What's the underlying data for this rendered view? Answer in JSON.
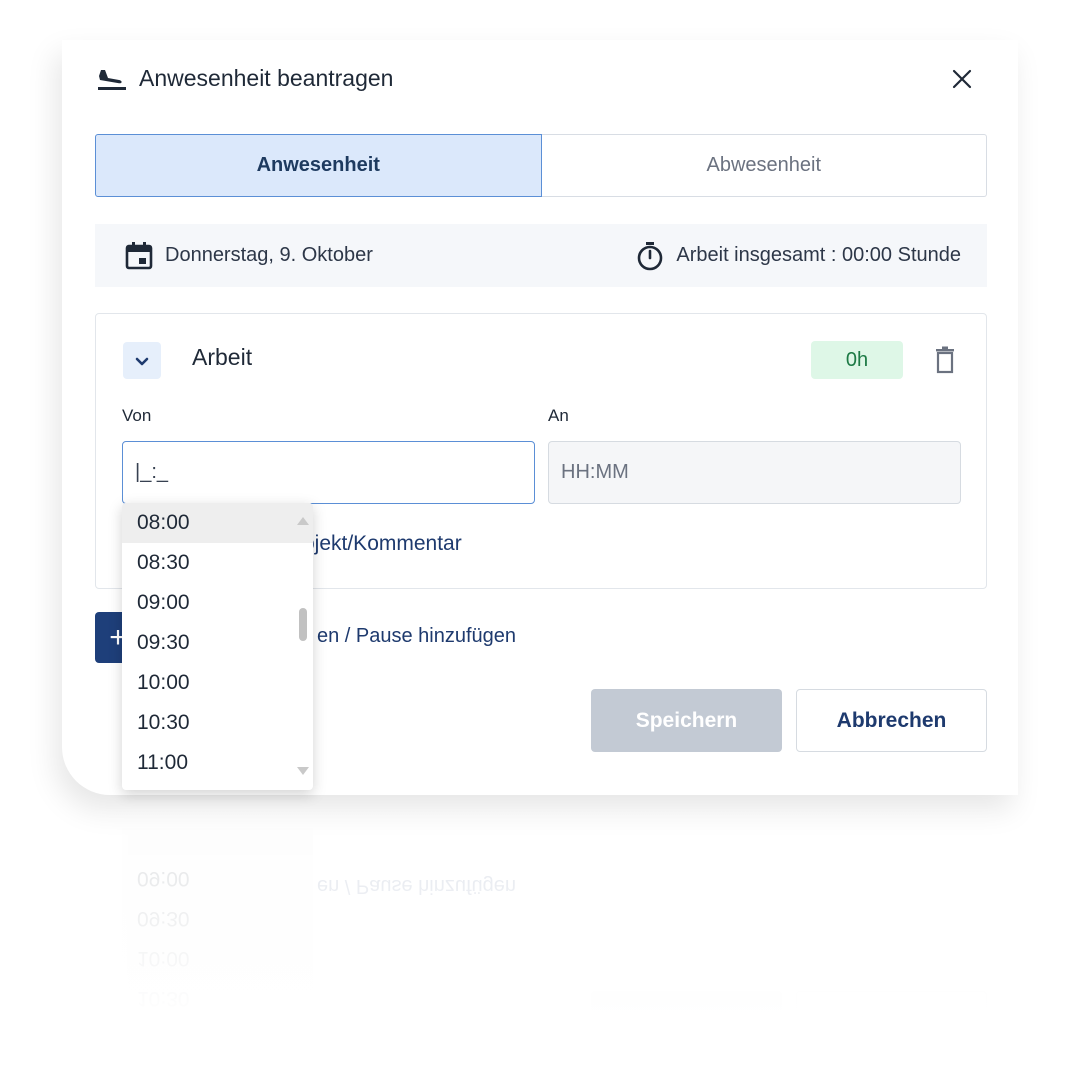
{
  "dialog": {
    "title": "Anwesenheit beantragen",
    "title_icon": "airplane-landing-icon",
    "close_icon": "close-icon"
  },
  "tabs": [
    {
      "label": "Anwesenheit",
      "active": true
    },
    {
      "label": "Abwesenheit",
      "active": false
    }
  ],
  "infobar": {
    "date": "Donnerstag, 9. Oktober",
    "date_icon": "calendar-icon",
    "total": "Arbeit insgesamt : 00:00 Stunde",
    "total_icon": "stopwatch-icon"
  },
  "entry": {
    "title": "Arbeit",
    "hours": "0h",
    "von_label": "Von",
    "von_value": "|_:_",
    "an_label": "An",
    "an_placeholder": "HH:MM",
    "comment_link": "Projekt/Kommentar",
    "comment_link_visible": "rojekt/Kommentar"
  },
  "add": {
    "link_visible": "en / Pause hinzufügen"
  },
  "buttons": {
    "save": "Speichern",
    "cancel": "Abbrechen"
  },
  "dropdown": {
    "options": [
      "08:00",
      "08:30",
      "09:00",
      "09:30",
      "10:00",
      "10:30",
      "11:00"
    ],
    "highlighted_index": 0
  },
  "colors": {
    "primary": "#1e3f7a",
    "tab_active_bg": "#dbe8fb",
    "badge_bg": "#def7e7",
    "badge_text": "#1d7a45",
    "save_disabled": "#c3cad4"
  }
}
